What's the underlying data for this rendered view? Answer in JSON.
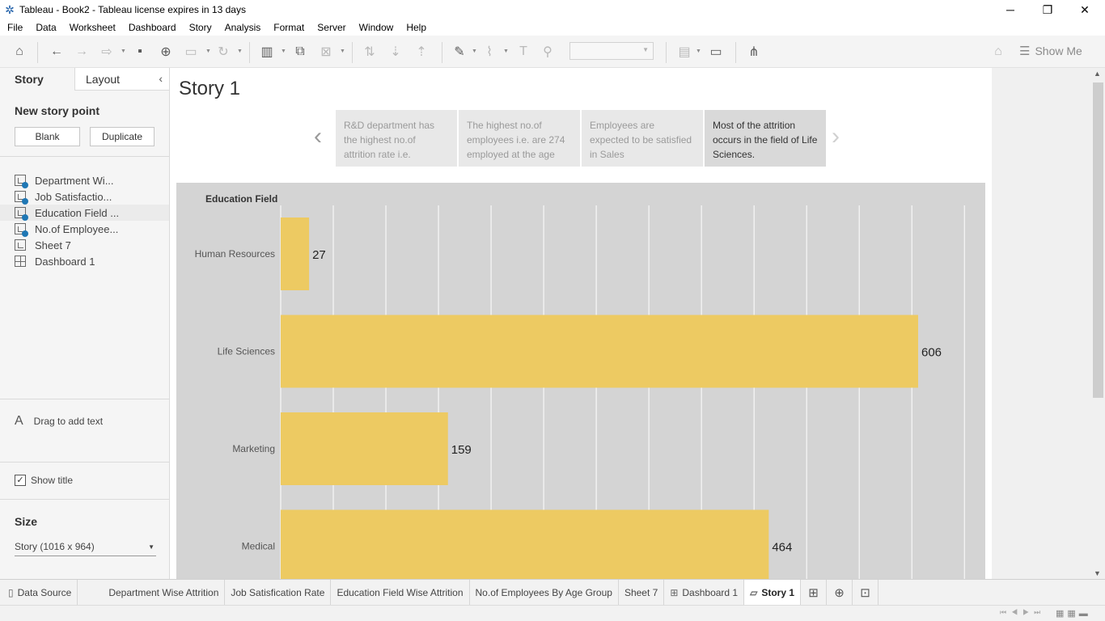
{
  "window": {
    "title": "Tableau - Book2 - Tableau license expires in 13 days",
    "icon": "tableau-logo-icon"
  },
  "menu": [
    "File",
    "Data",
    "Worksheet",
    "Dashboard",
    "Story",
    "Analysis",
    "Format",
    "Server",
    "Window",
    "Help"
  ],
  "toolbar": {
    "show_me_label": "Show Me"
  },
  "left_panel": {
    "tab_story": "Story",
    "tab_layout": "Layout",
    "new_story_point": "New story point",
    "blank_button": "Blank",
    "duplicate_button": "Duplicate",
    "sheets": [
      {
        "label": "Department Wi...",
        "type": "worksheet-used"
      },
      {
        "label": "Job Satisfactio...",
        "type": "worksheet-used"
      },
      {
        "label": "Education Field ...",
        "type": "worksheet-used"
      },
      {
        "label": "No.of Employee...",
        "type": "worksheet-used"
      },
      {
        "label": "Sheet 7",
        "type": "worksheet"
      },
      {
        "label": "Dashboard 1",
        "type": "dashboard"
      }
    ],
    "drag_text": "Drag to add text",
    "show_title_label": "Show title",
    "show_title_checked": true,
    "size_title": "Size",
    "size_value": "Story (1016 x 964)"
  },
  "story": {
    "title": "Story 1",
    "points": [
      {
        "text": "R&D department has the highest no.of attrition rate i.e.",
        "active": false
      },
      {
        "text": "The highest no.of employees i.e. are 274 employed at the age",
        "active": false
      },
      {
        "text": "Employees are expected to be satisfied in Sales",
        "active": false
      },
      {
        "text": "Most of the attrition occurs in the field of Life Sciences.",
        "active": true
      }
    ]
  },
  "chart_data": {
    "type": "bar",
    "orientation": "horizontal",
    "row_header": "Education Field",
    "categories": [
      "Human Resources",
      "Life Sciences",
      "Marketing",
      "Medical"
    ],
    "values": [
      27,
      606,
      159,
      464
    ],
    "data_labels": [
      "27",
      "606",
      "159",
      "464"
    ],
    "bar_color": "#EDCA62",
    "background_color": "#D4D4D4",
    "xlim": [
      0,
      650
    ],
    "grid": true
  },
  "bottom_tabs": [
    {
      "label": "Data Source",
      "icon": "data-source-icon",
      "active": false
    },
    {
      "label": "Department Wise Attrition",
      "icon": "",
      "active": false
    },
    {
      "label": "Job Satisfication Rate",
      "icon": "",
      "active": false
    },
    {
      "label": "Education Field Wise Attrition",
      "icon": "",
      "active": false
    },
    {
      "label": "No.of Employees By Age Group",
      "icon": "",
      "active": false
    },
    {
      "label": "Sheet 7",
      "icon": "",
      "active": false
    },
    {
      "label": "Dashboard 1",
      "icon": "dashboard-icon",
      "active": false
    },
    {
      "label": "Story 1",
      "icon": "story-icon",
      "active": true
    }
  ]
}
